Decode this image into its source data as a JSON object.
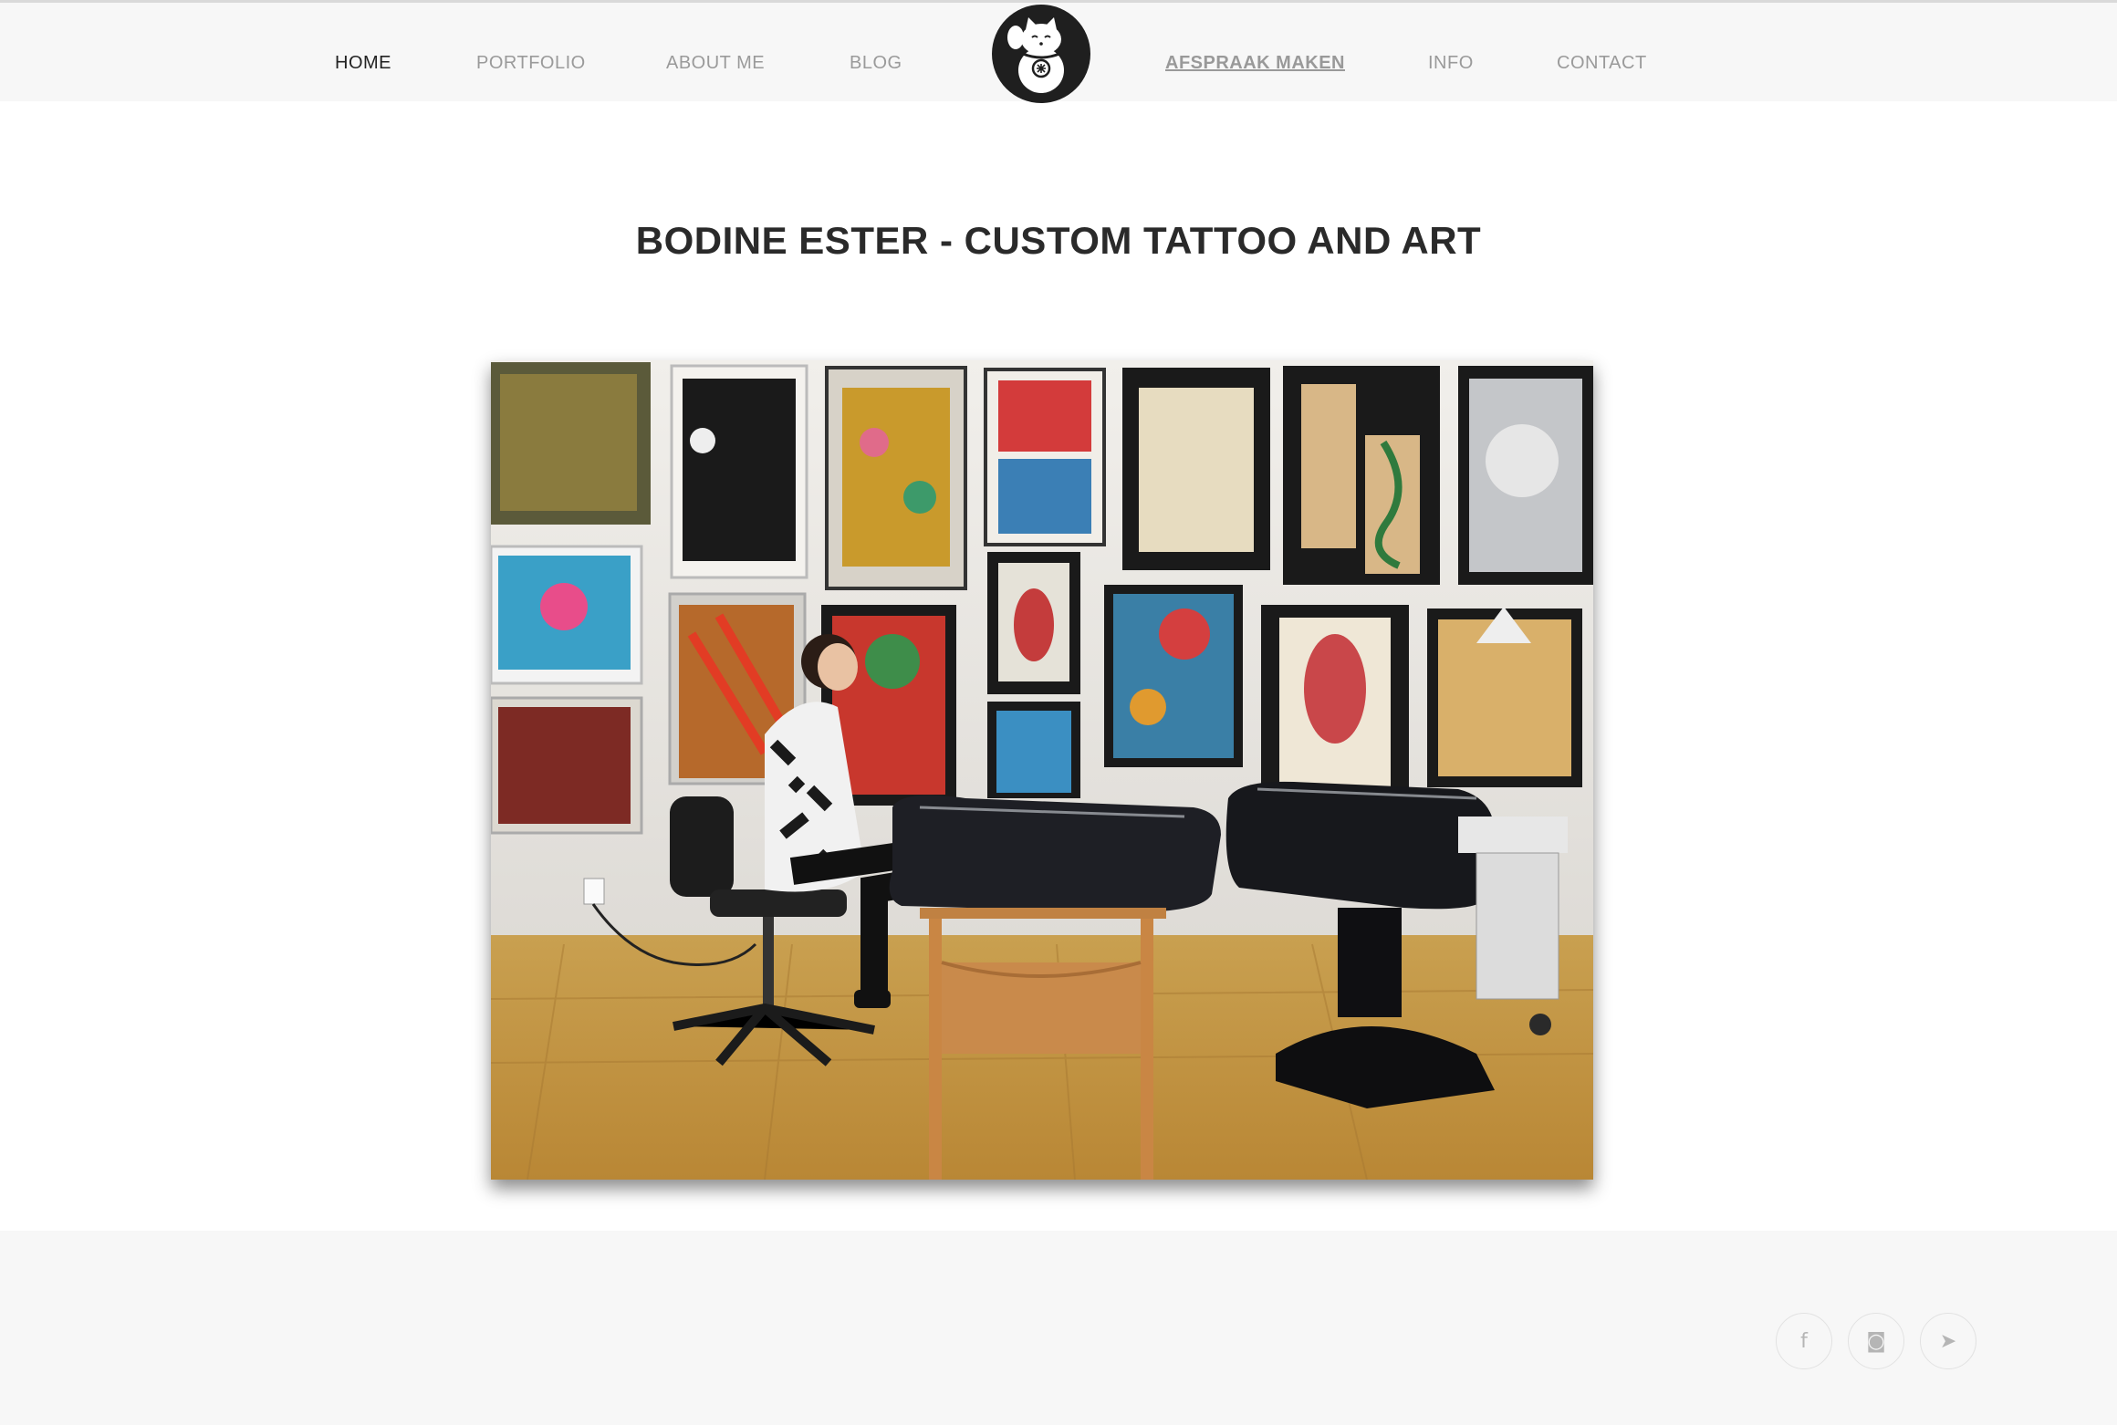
{
  "nav": {
    "home": "HOME",
    "portfolio": "PORTFOLIO",
    "about": "ABOUT ME",
    "blog": "BLOG",
    "appointment": "AFSPRAAK MAKEN",
    "info": "INFO",
    "contact": "CONTACT"
  },
  "logo": {
    "icon": "maneki-neko-cat-icon"
  },
  "main": {
    "title": "BODINE ESTER - CUSTOM TATTOO AND ART"
  },
  "hero": {
    "alt": "Tattoo studio with framed artwork on the wall, artist seated beside two tattoo beds"
  },
  "footer": {
    "social": {
      "facebook_icon": "f",
      "instagram_icon": "◙",
      "telegram_icon": "➤"
    }
  },
  "colors": {
    "accent": "#222222",
    "nav_inactive": "#9a9a9a",
    "header_bg": "#f7f7f7"
  }
}
